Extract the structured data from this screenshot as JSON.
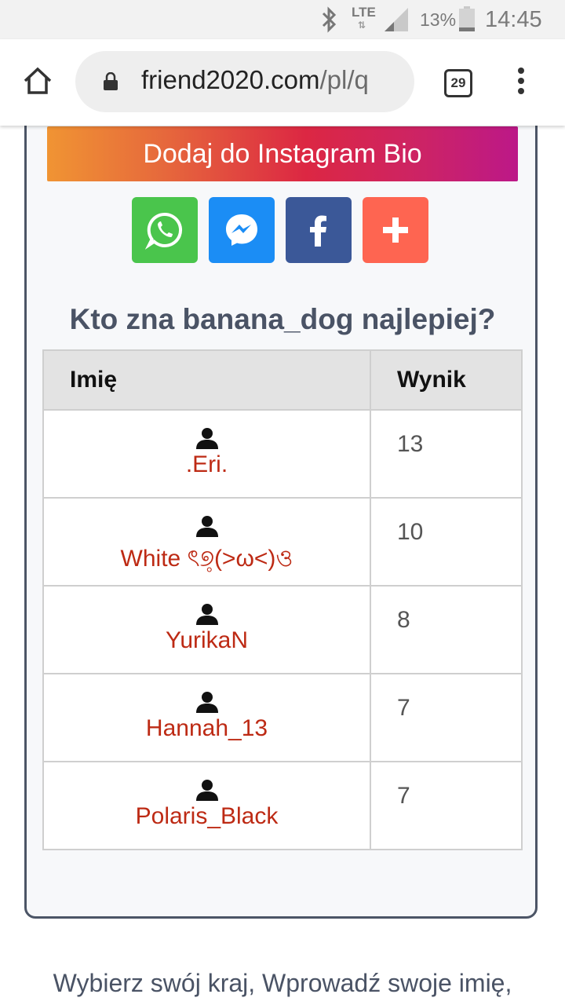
{
  "status_bar": {
    "network": "LTE",
    "battery": "13%",
    "time": "14:45"
  },
  "browser": {
    "url_host": "friend2020.com",
    "url_path": "/pl/q",
    "tab_count": "29"
  },
  "page": {
    "instagram_button": "Dodaj do Instagram Bio",
    "share_buttons": [
      "whatsapp-icon",
      "messenger-icon",
      "facebook-icon",
      "plus-icon"
    ],
    "table_title": "Kto zna banana_dog najlepiej?",
    "table": {
      "columns": [
        "Imię",
        "Wynik"
      ],
      "rows": [
        {
          "name": ".Eri.",
          "score": "13"
        },
        {
          "name": "White ৎ୭̥(>ω<)ও",
          "score": "10"
        },
        {
          "name": "YurikaN",
          "score": "8"
        },
        {
          "name": "Hannah_13",
          "score": "7"
        },
        {
          "name": "Polaris_Black",
          "score": "7"
        }
      ]
    },
    "footer_text": "Wybierz swój kraj, Wprowadź swoje imię,"
  },
  "colors": {
    "whatsapp": "#4ac54c",
    "messenger": "#1b8df5",
    "facebook": "#3b5898",
    "more": "#fe6551",
    "player_name": "#bd2a14"
  }
}
